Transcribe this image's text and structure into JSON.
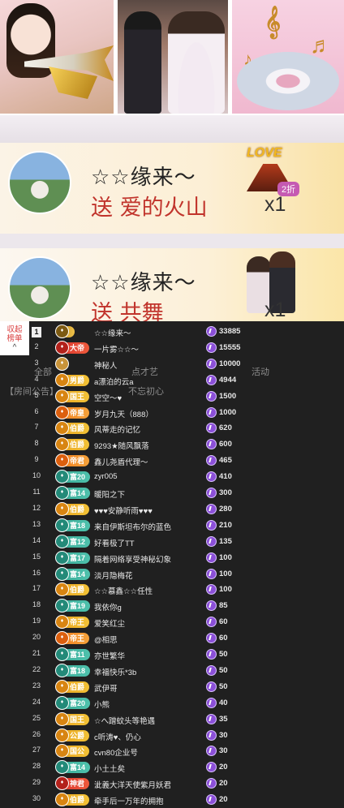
{
  "gift_banners": [
    {
      "sender": "☆☆缘来～",
      "action": "送 爱的火山",
      "count": "x1",
      "gift_label": "LOVE",
      "gift_tag": "2折"
    },
    {
      "sender": "☆☆缘来～",
      "action": "送 共舞",
      "count": "x1"
    }
  ],
  "leaderboard": {
    "tab_label_1": "収起",
    "tab_label_2": "榜单",
    "tab_chevron": "^",
    "rows": [
      {
        "rank": "1",
        "badge": "",
        "badge_style": "king",
        "name": "☆☆缘来～",
        "score": "33885"
      },
      {
        "rank": "2",
        "badge": "大帝",
        "badge_style": "red",
        "name": "一片雾☆☆～",
        "score": "15555"
      },
      {
        "rank": "3",
        "badge": "",
        "badge_style": "plain",
        "name": "神秘人",
        "score": "10000"
      },
      {
        "rank": "4",
        "badge": "男爵",
        "badge_style": "gold",
        "name": "a漂泊的云a",
        "score": "4944"
      },
      {
        "rank": "5",
        "badge": "国王",
        "badge_style": "gold",
        "name": "空空～♥",
        "score": "1500"
      },
      {
        "rank": "6",
        "badge": "帝皇",
        "badge_style": "orange",
        "name": "岁月九天（888）",
        "score": "1000"
      },
      {
        "rank": "7",
        "badge": "伯爵",
        "badge_style": "gold",
        "name": "风蒂走的记忆",
        "score": "620"
      },
      {
        "rank": "8",
        "badge": "伯爵",
        "badge_style": "gold",
        "name": "9293★随风飘落",
        "score": "600"
      },
      {
        "rank": "9",
        "badge": "帝君",
        "badge_style": "orange",
        "name": "鑫儿尧盾代理～",
        "score": "465"
      },
      {
        "rank": "10",
        "badge": "富20",
        "badge_style": "teal",
        "name": "zyr005",
        "score": "410"
      },
      {
        "rank": "11",
        "badge": "富14",
        "badge_style": "teal",
        "name": "暖阳之下",
        "score": "300"
      },
      {
        "rank": "12",
        "badge": "伯爵",
        "badge_style": "gold",
        "name": "♥♥♥安静听雨♥♥♥",
        "score": "280"
      },
      {
        "rank": "13",
        "badge": "富18",
        "badge_style": "teal",
        "name": "来自伊斯坦布尔的蓝色",
        "score": "210"
      },
      {
        "rank": "14",
        "badge": "富12",
        "badge_style": "teal",
        "name": "好看极了TT",
        "score": "135"
      },
      {
        "rank": "15",
        "badge": "富17",
        "badge_style": "teal",
        "name": "隔着网络享受神秘幻象",
        "score": "100"
      },
      {
        "rank": "16",
        "badge": "富14",
        "badge_style": "teal",
        "name": "淡月隐梅花",
        "score": "100"
      },
      {
        "rank": "17",
        "badge": "伯爵",
        "badge_style": "gold",
        "name": "☆☆慕鑫☆☆任性",
        "score": "100"
      },
      {
        "rank": "18",
        "badge": "富19",
        "badge_style": "teal",
        "name": "我依你g",
        "score": "85"
      },
      {
        "rank": "19",
        "badge": "帝王",
        "badge_style": "gold",
        "name": "爱笑红尘",
        "score": "60"
      },
      {
        "rank": "20",
        "badge": "帝王",
        "badge_style": "orange",
        "name": "@相思",
        "score": "60"
      },
      {
        "rank": "21",
        "badge": "富11",
        "badge_style": "teal",
        "name": "亦世繁华",
        "score": "50"
      },
      {
        "rank": "22",
        "badge": "富18",
        "badge_style": "teal",
        "name": "幸福快乐*3b",
        "score": "50"
      },
      {
        "rank": "23",
        "badge": "伯爵",
        "badge_style": "gold",
        "name": "武伊哥",
        "score": "50"
      },
      {
        "rank": "24",
        "badge": "富20",
        "badge_style": "teal",
        "name": "小熊",
        "score": "40"
      },
      {
        "rank": "25",
        "badge": "国王",
        "badge_style": "gold",
        "name": "☆へ蹭蚊头等艳遇",
        "score": "35"
      },
      {
        "rank": "26",
        "badge": "公爵",
        "badge_style": "gold",
        "name": "c听涛♥、仍心",
        "score": "30"
      },
      {
        "rank": "27",
        "badge": "国公",
        "badge_style": "gold",
        "name": "cvn80企业号",
        "score": "30"
      },
      {
        "rank": "28",
        "badge": "富14",
        "badge_style": "teal",
        "name": "小土土矣",
        "score": "20"
      },
      {
        "rank": "29",
        "badge": "神君",
        "badge_style": "red",
        "name": "泚義大洋天使紫月妖君",
        "score": "20"
      },
      {
        "rank": "30",
        "badge": "伯爵",
        "badge_style": "gold",
        "name": "牵手后一万年的拥抱",
        "score": "20"
      }
    ]
  },
  "background": {
    "tab_all": "全部",
    "tab_dianci": "点才艺",
    "tab_activity": "活动",
    "notice_1": "【房间公告】",
    "notice_2": "不忘初心"
  },
  "colors": {
    "accent": "#d93c3c",
    "coin": "#8b4fd8",
    "gold": "#e9a21c",
    "teal": "#36a996"
  }
}
